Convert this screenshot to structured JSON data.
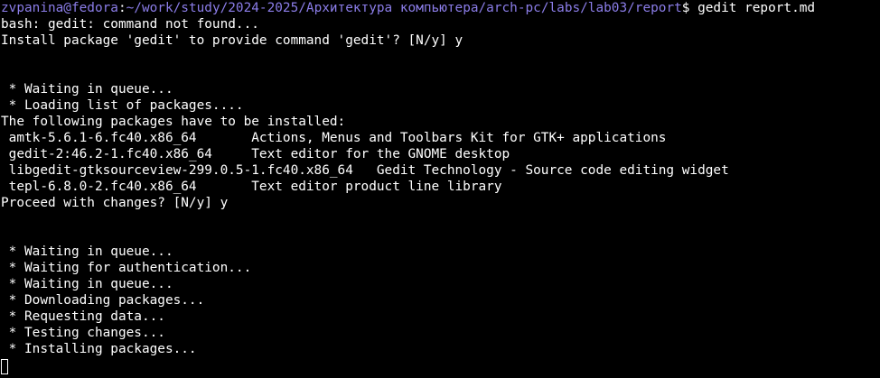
{
  "colors": {
    "background": "#000000",
    "text": "#ffffff",
    "prompt": "#8b7de8"
  },
  "prompt": {
    "user_host": "zvpanina@fedora",
    "separator": ":",
    "path": "~/work/study/2024-2025/Архитектура компьютера/arch-pc/labs/lab03/report",
    "symbol_and_command": "$ gedit report.md"
  },
  "lines": [
    "bash: gedit: command not found...",
    "Install package 'gedit' to provide command 'gedit'? [N/y] y",
    "",
    "",
    " * Waiting in queue...",
    " * Loading list of packages....",
    "The following packages have to be installed:",
    " amtk-5.6.1-6.fc40.x86_64       Actions, Menus and Toolbars Kit for GTK+ applications",
    " gedit-2:46.2-1.fc40.x86_64     Text editor for the GNOME desktop",
    " libgedit-gtksourceview-299.0.5-1.fc40.x86_64   Gedit Technology - Source code editing widget",
    " tepl-6.8.0-2.fc40.x86_64       Text editor product line library",
    "Proceed with changes? [N/y] y",
    "",
    "",
    " * Waiting in queue...",
    " * Waiting for authentication...",
    " * Waiting in queue...",
    " * Downloading packages...",
    " * Requesting data...",
    " * Testing changes...",
    " * Installing packages..."
  ]
}
